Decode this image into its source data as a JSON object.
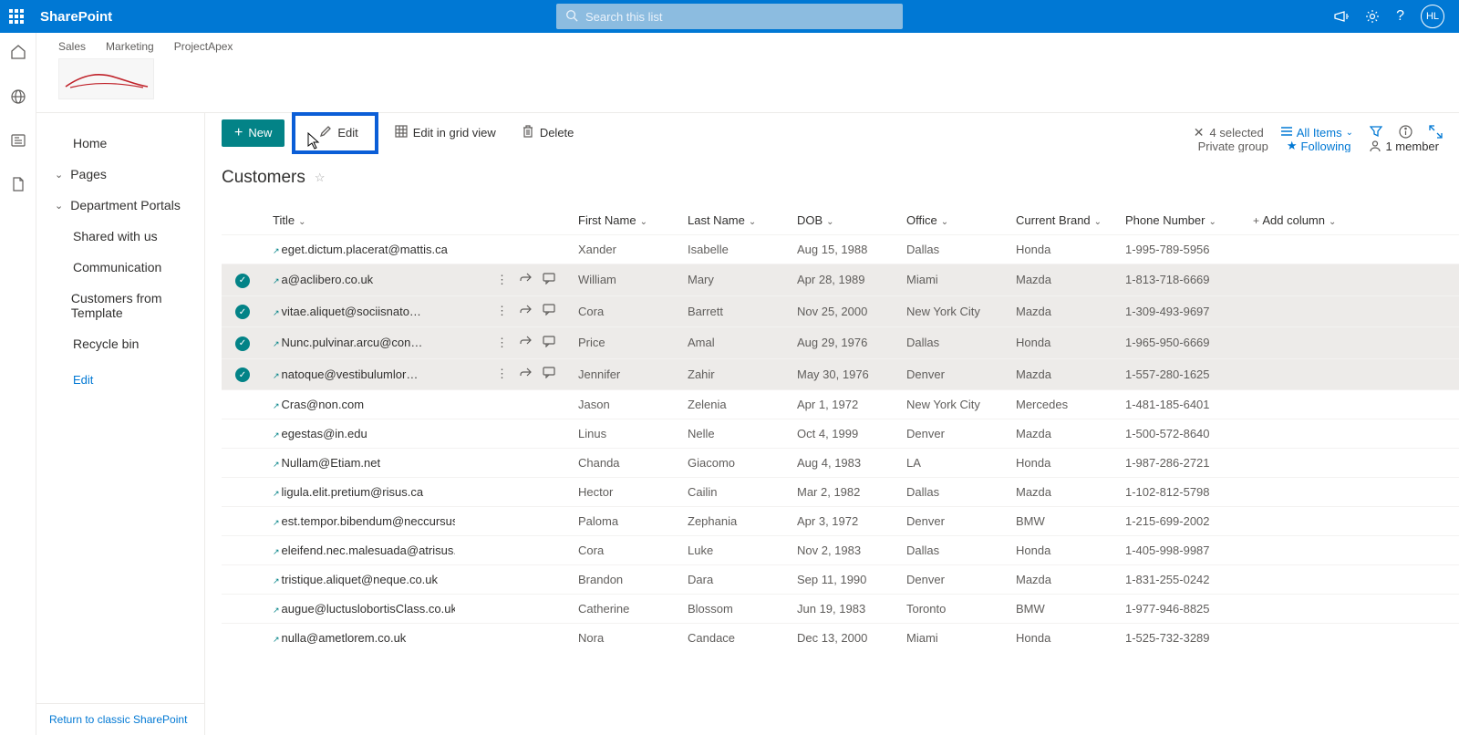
{
  "app_name": "SharePoint",
  "search_placeholder": "Search this list",
  "avatar_initials": "HL",
  "top_nav": [
    "Sales",
    "Marketing",
    "ProjectApex"
  ],
  "site_meta": {
    "group": "Private group",
    "following": "Following",
    "members": "1 member"
  },
  "left_nav": {
    "home": "Home",
    "pages": "Pages",
    "department": "Department Portals",
    "shared": "Shared with us",
    "communication": "Communication",
    "custtpl": "Customers from Template",
    "recycle": "Recycle bin",
    "edit": "Edit",
    "return": "Return to classic SharePoint"
  },
  "cmd": {
    "new": "New",
    "edit": "Edit",
    "grid": "Edit in grid view",
    "delete": "Delete",
    "selected": "4 selected",
    "allitems": "All Items"
  },
  "list_title": "Customers",
  "columns": {
    "title": "Title",
    "first": "First Name",
    "last": "Last Name",
    "dob": "DOB",
    "office": "Office",
    "brand": "Current Brand",
    "phone": "Phone Number",
    "add": "Add column"
  },
  "rows": [
    {
      "sel": false,
      "title": "eget.dictum.placerat@mattis.ca",
      "first": "Xander",
      "last": "Isabelle",
      "dob": "Aug 15, 1988",
      "office": "Dallas",
      "brand": "Honda",
      "phone": "1-995-789-5956"
    },
    {
      "sel": true,
      "title": "a@aclibero.co.uk",
      "first": "William",
      "last": "Mary",
      "dob": "Apr 28, 1989",
      "office": "Miami",
      "brand": "Mazda",
      "phone": "1-813-718-6669"
    },
    {
      "sel": true,
      "title": "vitae.aliquet@sociisnato…",
      "first": "Cora",
      "last": "Barrett",
      "dob": "Nov 25, 2000",
      "office": "New York City",
      "brand": "Mazda",
      "phone": "1-309-493-9697"
    },
    {
      "sel": true,
      "title": "Nunc.pulvinar.arcu@con…",
      "first": "Price",
      "last": "Amal",
      "dob": "Aug 29, 1976",
      "office": "Dallas",
      "brand": "Honda",
      "phone": "1-965-950-6669"
    },
    {
      "sel": true,
      "title": "natoque@vestibulumlor…",
      "first": "Jennifer",
      "last": "Zahir",
      "dob": "May 30, 1976",
      "office": "Denver",
      "brand": "Mazda",
      "phone": "1-557-280-1625"
    },
    {
      "sel": false,
      "title": "Cras@non.com",
      "first": "Jason",
      "last": "Zelenia",
      "dob": "Apr 1, 1972",
      "office": "New York City",
      "brand": "Mercedes",
      "phone": "1-481-185-6401"
    },
    {
      "sel": false,
      "title": "egestas@in.edu",
      "first": "Linus",
      "last": "Nelle",
      "dob": "Oct 4, 1999",
      "office": "Denver",
      "brand": "Mazda",
      "phone": "1-500-572-8640"
    },
    {
      "sel": false,
      "title": "Nullam@Etiam.net",
      "first": "Chanda",
      "last": "Giacomo",
      "dob": "Aug 4, 1983",
      "office": "LA",
      "brand": "Honda",
      "phone": "1-987-286-2721"
    },
    {
      "sel": false,
      "title": "ligula.elit.pretium@risus.ca",
      "first": "Hector",
      "last": "Cailin",
      "dob": "Mar 2, 1982",
      "office": "Dallas",
      "brand": "Mazda",
      "phone": "1-102-812-5798"
    },
    {
      "sel": false,
      "title": "est.tempor.bibendum@neccursusa.com",
      "first": "Paloma",
      "last": "Zephania",
      "dob": "Apr 3, 1972",
      "office": "Denver",
      "brand": "BMW",
      "phone": "1-215-699-2002"
    },
    {
      "sel": false,
      "title": "eleifend.nec.malesuada@atrisus.ca",
      "first": "Cora",
      "last": "Luke",
      "dob": "Nov 2, 1983",
      "office": "Dallas",
      "brand": "Honda",
      "phone": "1-405-998-9987"
    },
    {
      "sel": false,
      "title": "tristique.aliquet@neque.co.uk",
      "first": "Brandon",
      "last": "Dara",
      "dob": "Sep 11, 1990",
      "office": "Denver",
      "brand": "Mazda",
      "phone": "1-831-255-0242"
    },
    {
      "sel": false,
      "title": "augue@luctuslobortisClass.co.uk",
      "first": "Catherine",
      "last": "Blossom",
      "dob": "Jun 19, 1983",
      "office": "Toronto",
      "brand": "BMW",
      "phone": "1-977-946-8825"
    },
    {
      "sel": false,
      "title": "nulla@ametlorem.co.uk",
      "first": "Nora",
      "last": "Candace",
      "dob": "Dec 13, 2000",
      "office": "Miami",
      "brand": "Honda",
      "phone": "1-525-732-3289"
    }
  ]
}
